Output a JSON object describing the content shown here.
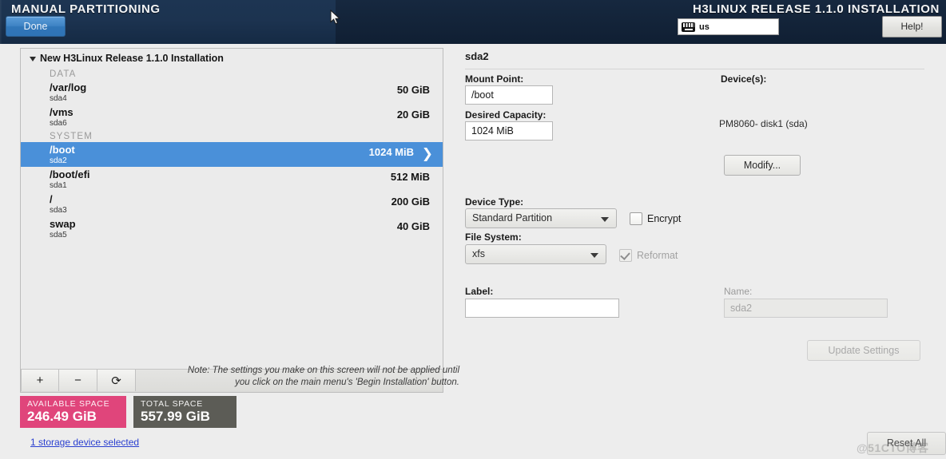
{
  "topbar": {
    "screen_title": "MANUAL PARTITIONING",
    "product_title": "H3LINUX RELEASE 1.1.0 INSTALLATION",
    "done_label": "Done",
    "help_label": "Help!",
    "keyboard_layout": "us",
    "keyboard_icon": "keyboard-icon"
  },
  "left_panel": {
    "root_label": "New H3Linux Release 1.1.0 Installation",
    "groups": [
      {
        "name": "DATA",
        "partitions": [
          {
            "mount_point": "/var/log",
            "device": "sda4",
            "size": "50 GiB",
            "selected": false
          },
          {
            "mount_point": "/vms",
            "device": "sda6",
            "size": "20 GiB",
            "selected": false
          }
        ]
      },
      {
        "name": "SYSTEM",
        "partitions": [
          {
            "mount_point": "/boot",
            "device": "sda2",
            "size": "1024 MiB",
            "selected": true
          },
          {
            "mount_point": "/boot/efi",
            "device": "sda1",
            "size": "512 MiB",
            "selected": false
          },
          {
            "mount_point": "/",
            "device": "sda3",
            "size": "200 GiB",
            "selected": false
          },
          {
            "mount_point": "swap",
            "device": "sda5",
            "size": "40 GiB",
            "selected": false
          }
        ]
      }
    ],
    "toolbar": {
      "add_label": "+",
      "remove_label": "−",
      "refresh_label": "⟳"
    },
    "available_space": {
      "label": "AVAILABLE SPACE",
      "value": "246.49 GiB",
      "color": "#e0457b"
    },
    "total_space": {
      "label": "TOTAL SPACE",
      "value": "557.99 GiB",
      "color": "#5c5c56"
    },
    "storage_link": "1 storage device selected"
  },
  "right_panel": {
    "title": "sda2",
    "mount_point": {
      "label": "Mount Point:",
      "value": "/boot"
    },
    "desired_capacity": {
      "label": "Desired Capacity:",
      "value": "1024 MiB"
    },
    "devices": {
      "label": "Device(s):",
      "value": "PM8060- disk1 (sda)",
      "modify_label": "Modify..."
    },
    "device_type": {
      "label": "Device Type:",
      "value": "Standard Partition"
    },
    "encrypt": {
      "label": "Encrypt",
      "checked": false
    },
    "file_system": {
      "label": "File System:",
      "value": "xfs"
    },
    "reformat": {
      "label": "Reformat",
      "checked": true
    },
    "label_field": {
      "label": "Label:",
      "value": ""
    },
    "name_field": {
      "label": "Name:",
      "value": "sda2"
    },
    "update_settings_label": "Update Settings",
    "note": "Note:  The settings you make on this screen will not be applied until you click on the main menu's 'Begin Installation' button."
  },
  "footer": {
    "reset_all_label": "Reset All",
    "watermark": "@51CTO博客"
  }
}
